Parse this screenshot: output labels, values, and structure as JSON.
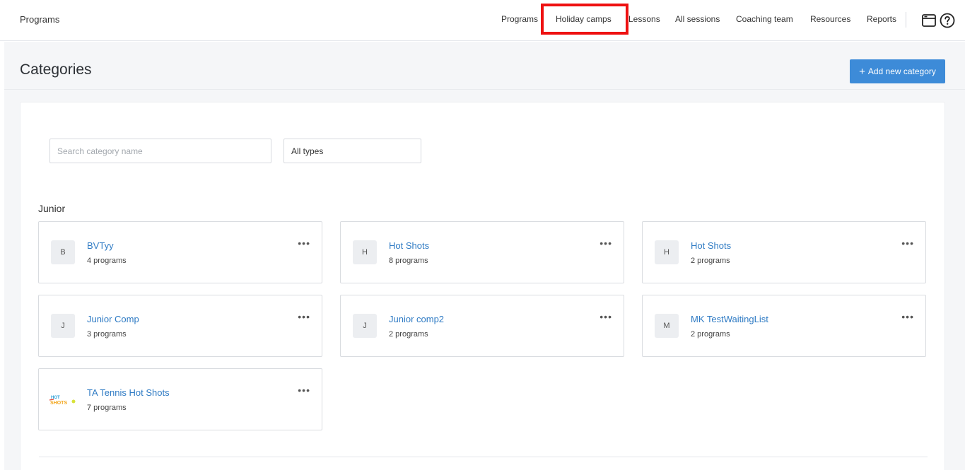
{
  "header": {
    "app_title": "Programs",
    "nav": [
      {
        "label": "Programs"
      },
      {
        "label": "Holiday camps"
      },
      {
        "label": "Lessons"
      },
      {
        "label": "All sessions"
      },
      {
        "label": "Coaching team"
      },
      {
        "label": "Resources"
      },
      {
        "label": "Reports"
      }
    ],
    "icons": [
      "window-icon",
      "help-icon"
    ]
  },
  "page": {
    "title": "Categories",
    "add_button_label": "Add new category"
  },
  "filters": {
    "search_placeholder": "Search category name",
    "search_value": "",
    "type_selected": "All types"
  },
  "group": {
    "label": "Junior",
    "cards": [
      {
        "initial": "B",
        "name": "BVTyy",
        "count": "4 programs"
      },
      {
        "initial": "H",
        "name": "Hot Shots",
        "count": "8 programs"
      },
      {
        "initial": "H",
        "name": "Hot Shots",
        "count": "2 programs"
      },
      {
        "initial": "J",
        "name": "Junior Comp",
        "count": "3 programs"
      },
      {
        "initial": "J",
        "name": "Junior comp2",
        "count": "2 programs"
      },
      {
        "initial": "M",
        "name": "MK TestWaitingList",
        "count": "2 programs"
      },
      {
        "initial": "",
        "name": "TA Tennis Hot Shots",
        "count": "7 programs",
        "logo": "hot-shots-logo"
      }
    ]
  },
  "colors": {
    "accent": "#3d8bd8",
    "link": "#2f7bc4",
    "highlight": "#ee1111",
    "background": "#f5f6f8"
  }
}
